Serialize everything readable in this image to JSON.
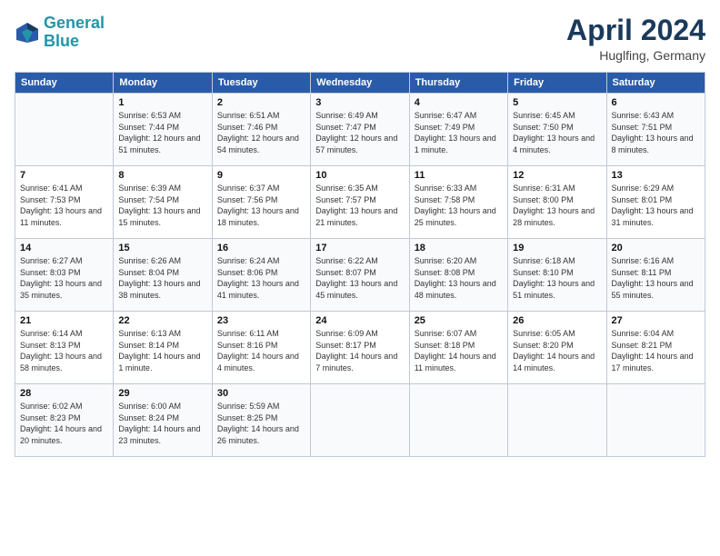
{
  "header": {
    "logo_line1": "General",
    "logo_line2": "Blue",
    "title": "April 2024",
    "location": "Huglfing, Germany"
  },
  "weekdays": [
    "Sunday",
    "Monday",
    "Tuesday",
    "Wednesday",
    "Thursday",
    "Friday",
    "Saturday"
  ],
  "weeks": [
    [
      {
        "day": "",
        "sunrise": "",
        "sunset": "",
        "daylight": ""
      },
      {
        "day": "1",
        "sunrise": "Sunrise: 6:53 AM",
        "sunset": "Sunset: 7:44 PM",
        "daylight": "Daylight: 12 hours and 51 minutes."
      },
      {
        "day": "2",
        "sunrise": "Sunrise: 6:51 AM",
        "sunset": "Sunset: 7:46 PM",
        "daylight": "Daylight: 12 hours and 54 minutes."
      },
      {
        "day": "3",
        "sunrise": "Sunrise: 6:49 AM",
        "sunset": "Sunset: 7:47 PM",
        "daylight": "Daylight: 12 hours and 57 minutes."
      },
      {
        "day": "4",
        "sunrise": "Sunrise: 6:47 AM",
        "sunset": "Sunset: 7:49 PM",
        "daylight": "Daylight: 13 hours and 1 minute."
      },
      {
        "day": "5",
        "sunrise": "Sunrise: 6:45 AM",
        "sunset": "Sunset: 7:50 PM",
        "daylight": "Daylight: 13 hours and 4 minutes."
      },
      {
        "day": "6",
        "sunrise": "Sunrise: 6:43 AM",
        "sunset": "Sunset: 7:51 PM",
        "daylight": "Daylight: 13 hours and 8 minutes."
      }
    ],
    [
      {
        "day": "7",
        "sunrise": "Sunrise: 6:41 AM",
        "sunset": "Sunset: 7:53 PM",
        "daylight": "Daylight: 13 hours and 11 minutes."
      },
      {
        "day": "8",
        "sunrise": "Sunrise: 6:39 AM",
        "sunset": "Sunset: 7:54 PM",
        "daylight": "Daylight: 13 hours and 15 minutes."
      },
      {
        "day": "9",
        "sunrise": "Sunrise: 6:37 AM",
        "sunset": "Sunset: 7:56 PM",
        "daylight": "Daylight: 13 hours and 18 minutes."
      },
      {
        "day": "10",
        "sunrise": "Sunrise: 6:35 AM",
        "sunset": "Sunset: 7:57 PM",
        "daylight": "Daylight: 13 hours and 21 minutes."
      },
      {
        "day": "11",
        "sunrise": "Sunrise: 6:33 AM",
        "sunset": "Sunset: 7:58 PM",
        "daylight": "Daylight: 13 hours and 25 minutes."
      },
      {
        "day": "12",
        "sunrise": "Sunrise: 6:31 AM",
        "sunset": "Sunset: 8:00 PM",
        "daylight": "Daylight: 13 hours and 28 minutes."
      },
      {
        "day": "13",
        "sunrise": "Sunrise: 6:29 AM",
        "sunset": "Sunset: 8:01 PM",
        "daylight": "Daylight: 13 hours and 31 minutes."
      }
    ],
    [
      {
        "day": "14",
        "sunrise": "Sunrise: 6:27 AM",
        "sunset": "Sunset: 8:03 PM",
        "daylight": "Daylight: 13 hours and 35 minutes."
      },
      {
        "day": "15",
        "sunrise": "Sunrise: 6:26 AM",
        "sunset": "Sunset: 8:04 PM",
        "daylight": "Daylight: 13 hours and 38 minutes."
      },
      {
        "day": "16",
        "sunrise": "Sunrise: 6:24 AM",
        "sunset": "Sunset: 8:06 PM",
        "daylight": "Daylight: 13 hours and 41 minutes."
      },
      {
        "day": "17",
        "sunrise": "Sunrise: 6:22 AM",
        "sunset": "Sunset: 8:07 PM",
        "daylight": "Daylight: 13 hours and 45 minutes."
      },
      {
        "day": "18",
        "sunrise": "Sunrise: 6:20 AM",
        "sunset": "Sunset: 8:08 PM",
        "daylight": "Daylight: 13 hours and 48 minutes."
      },
      {
        "day": "19",
        "sunrise": "Sunrise: 6:18 AM",
        "sunset": "Sunset: 8:10 PM",
        "daylight": "Daylight: 13 hours and 51 minutes."
      },
      {
        "day": "20",
        "sunrise": "Sunrise: 6:16 AM",
        "sunset": "Sunset: 8:11 PM",
        "daylight": "Daylight: 13 hours and 55 minutes."
      }
    ],
    [
      {
        "day": "21",
        "sunrise": "Sunrise: 6:14 AM",
        "sunset": "Sunset: 8:13 PM",
        "daylight": "Daylight: 13 hours and 58 minutes."
      },
      {
        "day": "22",
        "sunrise": "Sunrise: 6:13 AM",
        "sunset": "Sunset: 8:14 PM",
        "daylight": "Daylight: 14 hours and 1 minute."
      },
      {
        "day": "23",
        "sunrise": "Sunrise: 6:11 AM",
        "sunset": "Sunset: 8:16 PM",
        "daylight": "Daylight: 14 hours and 4 minutes."
      },
      {
        "day": "24",
        "sunrise": "Sunrise: 6:09 AM",
        "sunset": "Sunset: 8:17 PM",
        "daylight": "Daylight: 14 hours and 7 minutes."
      },
      {
        "day": "25",
        "sunrise": "Sunrise: 6:07 AM",
        "sunset": "Sunset: 8:18 PM",
        "daylight": "Daylight: 14 hours and 11 minutes."
      },
      {
        "day": "26",
        "sunrise": "Sunrise: 6:05 AM",
        "sunset": "Sunset: 8:20 PM",
        "daylight": "Daylight: 14 hours and 14 minutes."
      },
      {
        "day": "27",
        "sunrise": "Sunrise: 6:04 AM",
        "sunset": "Sunset: 8:21 PM",
        "daylight": "Daylight: 14 hours and 17 minutes."
      }
    ],
    [
      {
        "day": "28",
        "sunrise": "Sunrise: 6:02 AM",
        "sunset": "Sunset: 8:23 PM",
        "daylight": "Daylight: 14 hours and 20 minutes."
      },
      {
        "day": "29",
        "sunrise": "Sunrise: 6:00 AM",
        "sunset": "Sunset: 8:24 PM",
        "daylight": "Daylight: 14 hours and 23 minutes."
      },
      {
        "day": "30",
        "sunrise": "Sunrise: 5:59 AM",
        "sunset": "Sunset: 8:25 PM",
        "daylight": "Daylight: 14 hours and 26 minutes."
      },
      {
        "day": "",
        "sunrise": "",
        "sunset": "",
        "daylight": ""
      },
      {
        "day": "",
        "sunrise": "",
        "sunset": "",
        "daylight": ""
      },
      {
        "day": "",
        "sunrise": "",
        "sunset": "",
        "daylight": ""
      },
      {
        "day": "",
        "sunrise": "",
        "sunset": "",
        "daylight": ""
      }
    ]
  ]
}
